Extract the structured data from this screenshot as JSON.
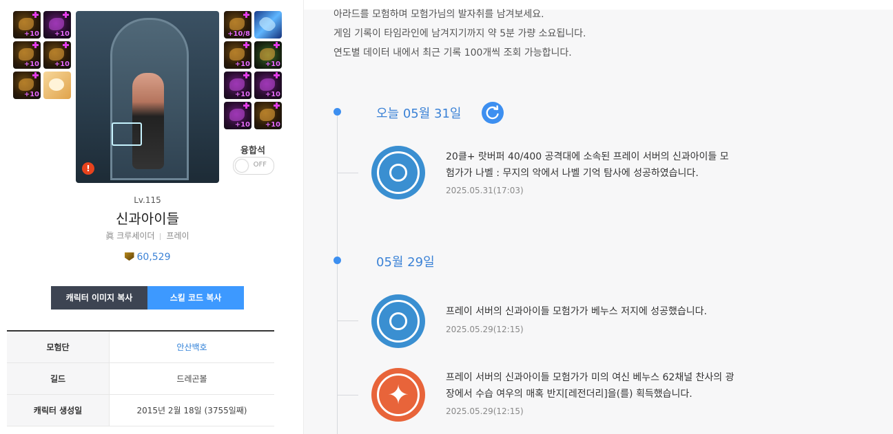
{
  "equipment": {
    "left_slots": [
      "+10",
      "+10",
      "+10",
      "+10",
      "+10",
      ""
    ],
    "right_slots": [
      "+10/8",
      "",
      "+10",
      "+10",
      "+10",
      "+10",
      "+10",
      "+10"
    ]
  },
  "character": {
    "level": "Lv.115",
    "name": "신과아이들",
    "job": "眞 크루세이더",
    "server": "프레이",
    "power": "60,529",
    "fusion_label": "융합석",
    "fusion_toggle": "OFF",
    "warning_glyph": "!"
  },
  "buttons": {
    "copy_image": "캐릭터 이미지 복사",
    "copy_skill": "스킬 코드 복사"
  },
  "info_table": [
    {
      "key": "모험단",
      "value": "안산백호"
    },
    {
      "key": "길드",
      "value": "드레곤볼"
    },
    {
      "key": "캐릭터 생성일",
      "value": "2015년 2월 18일 (3755일째)"
    }
  ],
  "timeline": {
    "intro_lines": [
      "아라드를 모험하며 모험가님의 발자취를 남겨보세요.",
      "게임 기록이 타임라인에 남겨지기까지 약 5분 가량 소요됩니다.",
      "연도별 데이터 내에서 최근 기록 100개씩 조회 가능합니다."
    ],
    "groups": [
      {
        "date": "오늘 05월 31일",
        "events": [
          {
            "text": "20클+ 랏버퍼 40/400 공격대에 소속된 프레이 서버의 신과아이들 모험가가 나벨 : 무지의 악에서 나벨 기억 탐사에 성공하였습니다.",
            "time": "2025.05.31(17:03)",
            "icon": "raid-emblem-icon",
            "color": "#3a8fd1"
          }
        ]
      },
      {
        "date": "05월 29일",
        "events": [
          {
            "text": "프레이 서버의 신과아이들 모험가가 베누스 저지에 성공했습니다.",
            "time": "2025.05.29(12:15)",
            "icon": "venus-emblem-icon",
            "color": "#3a8fd1"
          },
          {
            "text": "프레이 서버의 신과아이들 모험가가 미의 여신 베누스 62채널 찬사의 광장에서 수습 여우의 매혹 반지[레전더리]을(를) 획득했습니다.",
            "time": "2025.05.29(12:15)",
            "icon": "legendary-star-icon",
            "color": "#e8643a"
          }
        ]
      }
    ]
  }
}
